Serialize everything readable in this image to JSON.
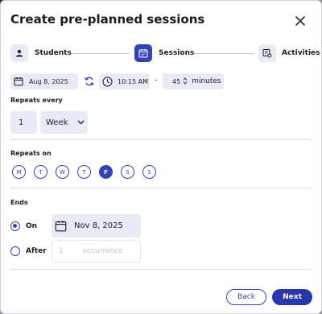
{
  "dialog": {
    "title": "Create pre-planned sessions"
  },
  "steps": [
    {
      "label": "Students",
      "icon": "person-icon",
      "active": false
    },
    {
      "label": "Sessions",
      "icon": "calendar-icon",
      "active": true
    },
    {
      "label": "Activities",
      "icon": "activities-icon",
      "active": false
    }
  ],
  "schedule": {
    "date": "Aug 8, 2025",
    "time": "10:15 AM",
    "separator": "-",
    "duration_value": "45",
    "duration_unit": "minutes"
  },
  "repeats": {
    "label": "Repeats every",
    "interval": "1",
    "unit": "Week"
  },
  "repeats_on": {
    "label": "Repeats on",
    "days": [
      "M",
      "T",
      "W",
      "T",
      "F",
      "S",
      "S"
    ],
    "selected_index": 4
  },
  "ends": {
    "label": "Ends",
    "on_label": "On",
    "on_date": "Nov 8, 2025",
    "after_label": "After",
    "after_value": "1",
    "after_unit": "occurrence"
  },
  "footer": {
    "back_label": "Back",
    "next_label": "Next"
  },
  "colors": {
    "accent": "#3443b4",
    "tint": "#e8eaf6"
  }
}
